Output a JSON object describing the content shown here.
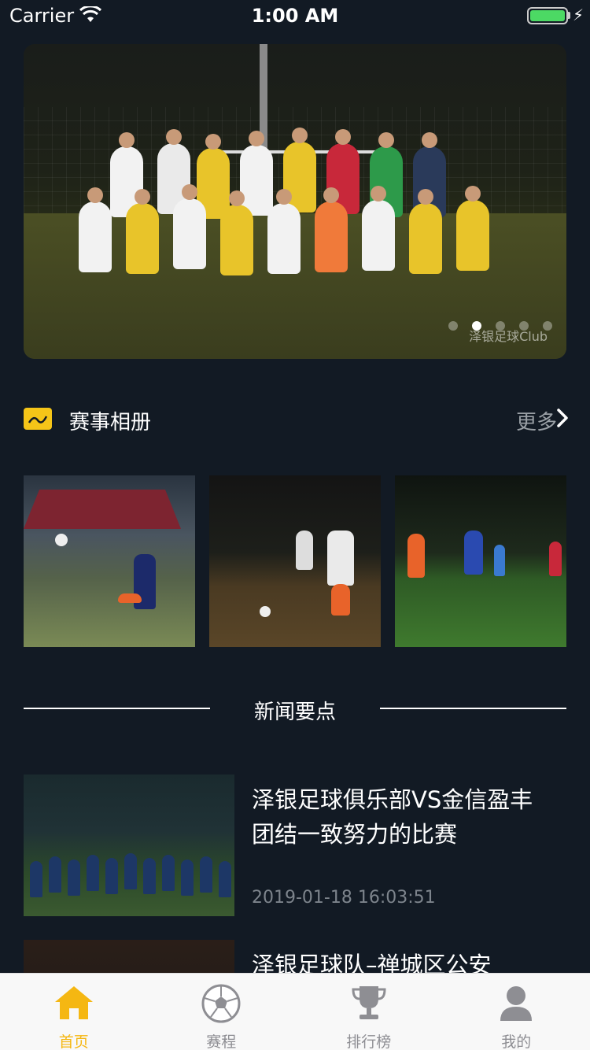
{
  "status_bar": {
    "carrier": "Carrier",
    "time": "1:00 AM"
  },
  "banner": {
    "watermark": "泽银足球Club",
    "page_count": 5,
    "active_page": 2
  },
  "album_section": {
    "title": "赛事相册",
    "more_label": "更多"
  },
  "news_section": {
    "title": "新闻要点",
    "items": [
      {
        "title": "泽银足球俱乐部VS金信盈丰 团结一致努力的比赛",
        "time": "2019-01-18 16:03:51"
      },
      {
        "title": "泽银足球队–禅城区公安",
        "time": ""
      }
    ]
  },
  "tabbar": {
    "items": [
      {
        "label": "首页",
        "icon": "home-icon",
        "active": true
      },
      {
        "label": "赛程",
        "icon": "soccer-ball-icon",
        "active": false
      },
      {
        "label": "排行榜",
        "icon": "trophy-icon",
        "active": false
      },
      {
        "label": "我的",
        "icon": "user-icon",
        "active": false
      }
    ]
  },
  "colors": {
    "background": "#121a24",
    "accent": "#f5b712",
    "tab_inactive": "#8e8e93",
    "timestamp": "#7d848c"
  }
}
